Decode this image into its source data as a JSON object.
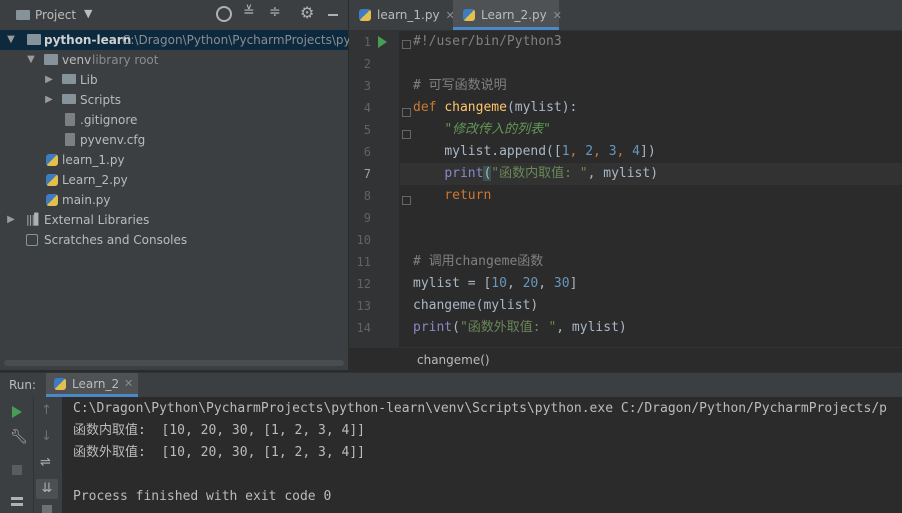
{
  "project": {
    "title": "Project",
    "tree": [
      {
        "label": "python-learn",
        "detail": "C:\\Dragon\\Python\\PycharmProjects\\pytho",
        "kind": "folder"
      },
      {
        "label": "venv",
        "detail": "library root",
        "kind": "folder"
      },
      {
        "label": "Lib",
        "kind": "folder"
      },
      {
        "label": "Scripts",
        "kind": "folder"
      },
      {
        "label": ".gitignore",
        "kind": "file"
      },
      {
        "label": "pyvenv.cfg",
        "kind": "file"
      },
      {
        "label": "learn_1.py",
        "kind": "py"
      },
      {
        "label": "Learn_2.py",
        "kind": "py"
      },
      {
        "label": "main.py",
        "kind": "py"
      },
      {
        "label": "External Libraries",
        "kind": "lib"
      },
      {
        "label": "Scratches and Consoles",
        "kind": "scratch"
      }
    ]
  },
  "editor": {
    "tabs": [
      {
        "label": "learn_1.py",
        "close": "✕"
      },
      {
        "label": "Learn_2.py",
        "close": "✕"
      }
    ],
    "line_numbers": [
      "1",
      "2",
      "3",
      "4",
      "5",
      "6",
      "7",
      "8",
      "9",
      "10",
      "11",
      "12",
      "13",
      "14"
    ],
    "code": {
      "l1": "#!/user/bin/Python3",
      "l3": "# 可写函数说明",
      "l4_def": "def",
      "l4_name": "changeme",
      "l4_rest": "(mylist):",
      "l5": "\"修改传入的列表\"",
      "l6_a": "mylist.append([",
      "l6_n1": "1",
      "l6_n2": "2",
      "l6_n3": "3",
      "l6_n4": "4",
      "l6_b": "])",
      "l7_print": "print",
      "l7_str": "\"函数内取值: \"",
      "l7_rest": ", mylist)",
      "l8": "return",
      "l11_a": "# 调用",
      "l11_b": "changeme",
      "l11_c": "函数",
      "l12_a": "mylist = [",
      "l12_n1": "10",
      "l12_n2": "20",
      "l12_n3": "30",
      "l12_b": "]",
      "l13": "changeme(mylist)",
      "l14_print": "print",
      "l14_str": "\"函数外取值: \"",
      "l14_rest": ", mylist)"
    },
    "breadcrumb": "changeme()"
  },
  "run": {
    "label": "Run:",
    "tab": "Learn_2",
    "output": [
      "C:\\Dragon\\Python\\PycharmProjects\\python-learn\\venv\\Scripts\\python.exe C:/Dragon/Python/PycharmProjects/p",
      "函数内取值:  [10, 20, 30, [1, 2, 3, 4]]",
      "函数外取值:  [10, 20, 30, [1, 2, 3, 4]]",
      "",
      "Process finished with exit code 0"
    ]
  }
}
